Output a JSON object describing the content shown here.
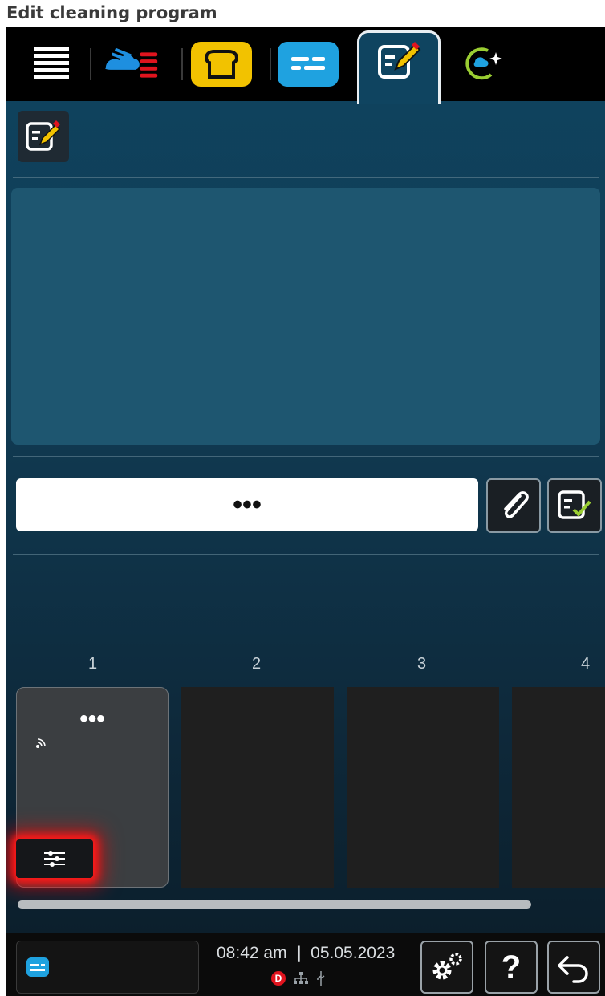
{
  "caption": "Edit cleaning program",
  "topbar": {
    "tabs": [
      {
        "name": "menu-icon"
      },
      {
        "name": "steam-heat-icon"
      },
      {
        "name": "bakery-bread-icon"
      },
      {
        "name": "program-list-icon"
      },
      {
        "name": "edit-program-icon",
        "active": true
      },
      {
        "name": "cleaning-program-icon"
      }
    ]
  },
  "header": {
    "edit_icon": "edit-icon"
  },
  "program_name": {
    "value": "•••"
  },
  "columns": [
    "1",
    "2",
    "3",
    "4"
  ],
  "step_card": {
    "label": "•••"
  },
  "bottombar": {
    "time": "08:42 am",
    "date": "05.05.2023",
    "status_badge": "D"
  },
  "colors": {
    "accent_blue": "#1fa2e0",
    "accent_yellow": "#f2c200",
    "highlight_red": "#ff1a1a"
  }
}
